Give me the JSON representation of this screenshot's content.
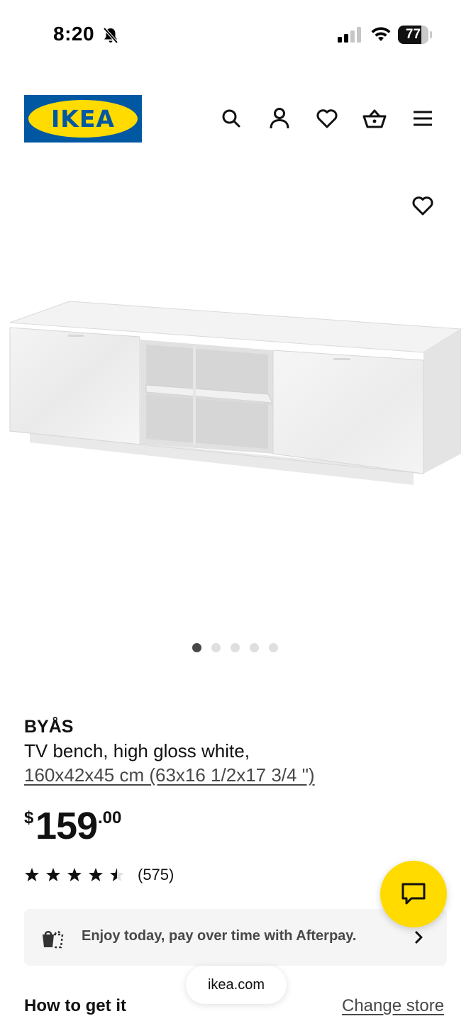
{
  "status_bar": {
    "time": "8:20",
    "battery_level": "77",
    "battery_fraction": 0.77,
    "icons": [
      "bell-slash-icon",
      "cellular-signal-icon",
      "wifi-icon",
      "battery-icon"
    ]
  },
  "header": {
    "logo_text": "IKEA",
    "brand_colors": {
      "blue": "#0058a3",
      "yellow": "#ffdb00"
    },
    "icons": [
      "search-icon",
      "account-icon",
      "heart-icon",
      "basket-icon",
      "menu-icon"
    ]
  },
  "gallery": {
    "image_count": 5,
    "active_index": 0
  },
  "product": {
    "name": "BYÅS",
    "description": "TV bench, high gloss white,",
    "dimensions": "160x42x45 cm (63x16 1/2x17 3/4 \")",
    "price_currency": "$",
    "price_integer": "159",
    "price_decimal": ".00",
    "rating": 4.5,
    "rating_max": 5,
    "review_count": "(575)"
  },
  "afterpay": {
    "text": "Enjoy today, pay over time with Afterpay."
  },
  "browser": {
    "url": "ikea.com"
  },
  "delivery": {
    "title": "How to get it",
    "change_store": "Change store"
  }
}
